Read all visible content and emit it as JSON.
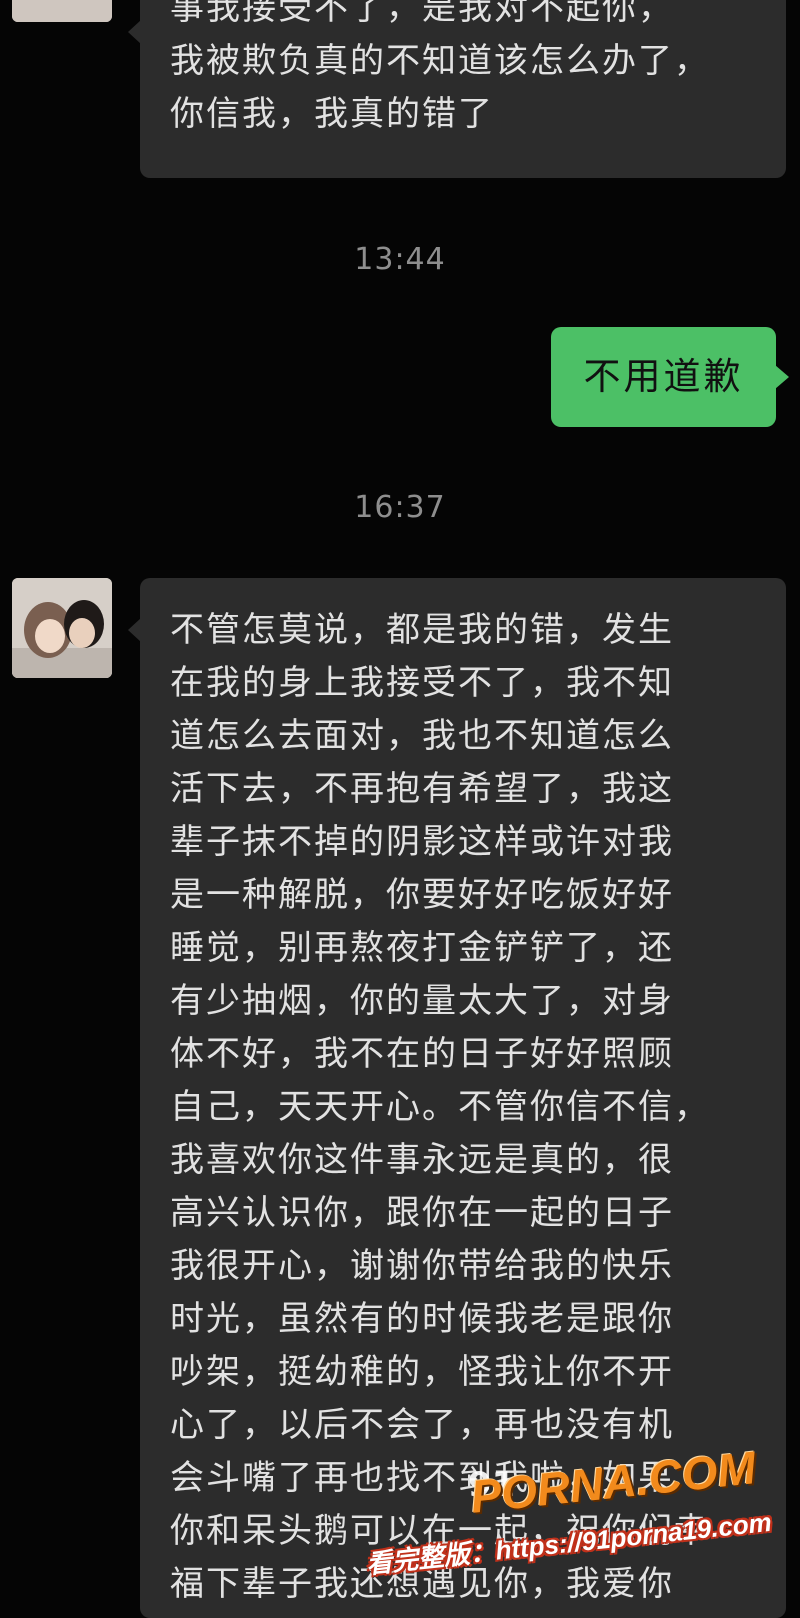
{
  "messages": {
    "top_incoming": {
      "lines": [
        "事我接受不了，是我对不起你，",
        "我被欺负真的不知道该怎么办了，",
        "你信我，我真的错了"
      ]
    },
    "timestamp_1": "13:44",
    "outgoing": {
      "text": "不用道歉"
    },
    "timestamp_2": "16:37",
    "main_incoming": {
      "lines": [
        "不管怎莫说，都是我的错，发生",
        "在我的身上我接受不了，我不知",
        "道怎么去面对，我也不知道怎么",
        "活下去，不再抱有希望了，我这",
        "辈子抹不掉的阴影这样或许对我",
        "是一种解脱，你要好好吃饭好好",
        "睡觉，别再熬夜打金铲铲了，还",
        "有少抽烟，你的量太大了，对身",
        "体不好，我不在的日子好好照顾",
        "自己，天天开心。不管你信不信，",
        "我喜欢你这件事永远是真的，很",
        "高兴认识你，跟你在一起的日子",
        "我很开心，谢谢你带给我的快乐",
        "时光，虽然有的时候我老是跟你",
        "吵架，挺幼稚的，怪我让你不开",
        "心了，以后不会了，再也没有机",
        "会斗嘴了再也找不到我啦，如果",
        "你和呆头鹅可以在一起，祝你们幸",
        "福下辈子我还想遇见你，我爱你"
      ]
    }
  },
  "watermark": {
    "small_text": "91",
    "logo_text": "PORNA.COM",
    "url_text": "看完整版：https://91porna19.com"
  },
  "colors": {
    "background": "#050505",
    "incoming_bubble": "#2c2c2c",
    "outgoing_bubble": "#4cc066",
    "timestamp": "#8e8e8e"
  }
}
